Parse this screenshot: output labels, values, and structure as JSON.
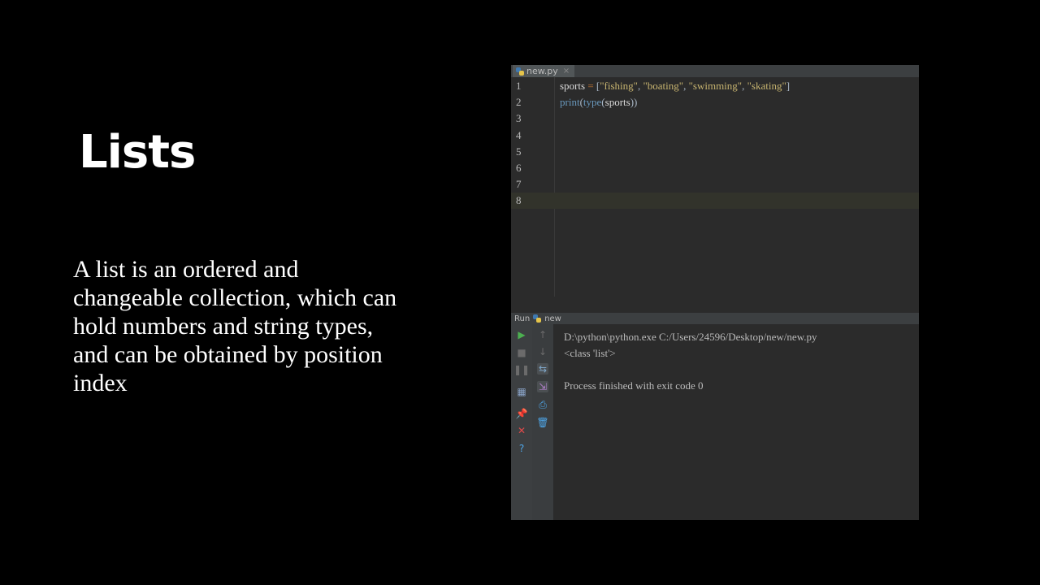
{
  "slide": {
    "title": "Lists",
    "body": "A list is an ordered and changeable collection, which can hold numbers and string types, and can be obtained by position index"
  },
  "ide": {
    "tab": {
      "label": "new.py",
      "close_glyph": "×"
    },
    "lines": [
      {
        "number": "1",
        "tokens": [
          {
            "t": "sports",
            "c": "id"
          },
          {
            "t": " = ",
            "c": "op"
          },
          {
            "t": "[",
            "c": "p"
          },
          {
            "t": "\"fishing\"",
            "c": "str"
          },
          {
            "t": ", ",
            "c": "p"
          },
          {
            "t": "\"boating\"",
            "c": "str"
          },
          {
            "t": ", ",
            "c": "p"
          },
          {
            "t": "\"swimming\"",
            "c": "str"
          },
          {
            "t": ", ",
            "c": "p"
          },
          {
            "t": "\"skating\"",
            "c": "str"
          },
          {
            "t": "]",
            "c": "p"
          }
        ]
      },
      {
        "number": "2",
        "tokens": [
          {
            "t": "print",
            "c": "bi"
          },
          {
            "t": "(",
            "c": "p"
          },
          {
            "t": "type",
            "c": "bi"
          },
          {
            "t": "(",
            "c": "p"
          },
          {
            "t": "sports",
            "c": "id"
          },
          {
            "t": "))",
            "c": "p"
          }
        ]
      },
      {
        "number": "3",
        "tokens": []
      },
      {
        "number": "4",
        "tokens": []
      },
      {
        "number": "5",
        "tokens": []
      },
      {
        "number": "6",
        "tokens": []
      },
      {
        "number": "7",
        "tokens": []
      },
      {
        "number": "8",
        "tokens": [],
        "active": true
      }
    ],
    "run": {
      "header_label": "Run",
      "config_name": "new",
      "output": [
        "D:\\python\\python.exe C:/Users/24596/Desktop/new/new.py",
        "<class 'list'>",
        "",
        "Process finished with exit code 0"
      ],
      "left_icons": [
        {
          "name": "run-icon",
          "glyph": "▶",
          "color": "#4caf50"
        },
        {
          "name": "stop-icon",
          "glyph": "■",
          "color": "#6b6b6b"
        },
        {
          "name": "pause-icon",
          "glyph": "❚❚",
          "color": "#6b6b6b"
        },
        {
          "name": "layout-icon",
          "glyph": "▦",
          "color": "#8aa4c8"
        },
        {
          "name": "pin-icon",
          "glyph": "📌",
          "color": "#c08ad8"
        },
        {
          "name": "close-icon",
          "glyph": "✕",
          "color": "#e04a4a"
        },
        {
          "name": "help-icon",
          "glyph": "?",
          "color": "#4ea6e8"
        }
      ],
      "right_icons": [
        {
          "name": "up-arrow-icon",
          "glyph": "↑",
          "color": "#6b6b6b"
        },
        {
          "name": "down-arrow-icon",
          "glyph": "↓",
          "color": "#6b6b6b"
        },
        {
          "name": "soft-wrap-icon",
          "glyph": "⇆",
          "color": "#7fa7c9"
        },
        {
          "name": "scroll-to-end-icon",
          "glyph": "⇲",
          "color": "#b07fc9"
        },
        {
          "name": "print-icon",
          "glyph": "⎙",
          "color": "#4ea6e8"
        },
        {
          "name": "clear-icon",
          "glyph": "🗑",
          "color": "#4ea6e8"
        }
      ]
    }
  },
  "colors": {
    "background": "#000000",
    "ide_bg": "#2b2b2b",
    "string": "#c6b36f",
    "keyword": "#cc7832",
    "builtin": "#6897bb"
  }
}
